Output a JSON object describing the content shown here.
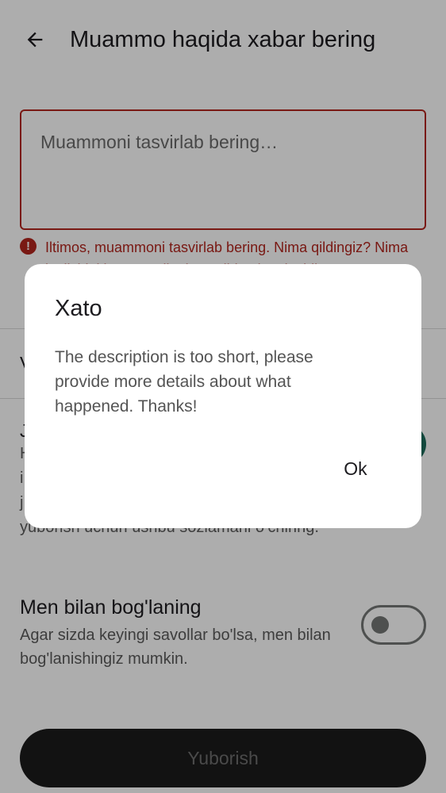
{
  "header": {
    "title": "Muammo haqida xabar bering",
    "back_icon": "arrow-back-icon"
  },
  "description": {
    "placeholder": "Muammoni tasvirlab bering…",
    "error_icon": "error-circle-icon",
    "error_message": "Iltimos, muammoni tasvirlab bering. Nima qildingiz? Nima bo'lishini kutgan edingiz? Aslida nima bo'ldi?"
  },
  "sections": {
    "obscured_row_label": "V",
    "obscured_option_title": "J",
    "obscured_option_desc": "H\ni\nj\nyuborish uchun ushbu sozlamani o‘chiring.",
    "obscured_option_switch_on": true
  },
  "contact": {
    "title": "Men bilan bog'laning",
    "description": "Agar sizda keyingi savollar bo'lsa, men bilan bog'lanishingiz mumkin.",
    "switch_on": false
  },
  "submit": {
    "label": "Yuborish"
  },
  "dialog": {
    "title": "Xato",
    "message": "The description is too short, please provide more details about what happened. Thanks!",
    "ok_label": "Ok"
  },
  "colors": {
    "error": "#b3261e",
    "switch_on": "#1b6b5a",
    "scrim": "rgba(0,0,0,0.32)"
  }
}
